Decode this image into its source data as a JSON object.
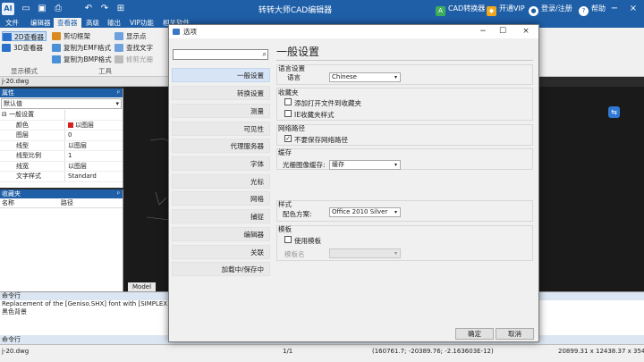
{
  "titlebar": {
    "logo": "AI",
    "title": "转转大师CAD编辑器",
    "converter": "CAD转换器",
    "vip": "开通VIP",
    "login": "登录/注册",
    "help": "帮助"
  },
  "menu": {
    "tabs": [
      "文件",
      "编辑器",
      "查看器",
      "高级",
      "输出",
      "VIP功能",
      "相关软件"
    ]
  },
  "ribbon": {
    "btn_2d": "2D查看器",
    "btn_3d": "3D查看器",
    "btn_clip": "剪切框架",
    "btn_emf": "复制为EMF格式",
    "btn_bmp": "复制为BMP格式",
    "btn_points": "显示点",
    "btn_find": "查找文字",
    "btn_trim": "修剪光栅",
    "group_display": "显示模式",
    "group_tools": "工具"
  },
  "file_tab": "j-20.dwg",
  "properties": {
    "header": "属性",
    "combo_value": "默认值",
    "group": "一般设置",
    "rows": [
      {
        "k": "颜色",
        "v": "以图层"
      },
      {
        "k": "图层",
        "v": "0"
      },
      {
        "k": "线型",
        "v": "以图层"
      },
      {
        "k": "线型比例",
        "v": "1"
      },
      {
        "k": "线宽",
        "v": "以图层"
      },
      {
        "k": "文字样式",
        "v": "Standard"
      }
    ]
  },
  "favorites": {
    "header": "收藏夹",
    "col_name": "名称",
    "col_path": "路径"
  },
  "canvas": {
    "model_tab": "Model"
  },
  "command": {
    "header": "命令行",
    "lines": [
      "Replacement of the [Geniso.SHX] font with [SIMPLEX.SHX]",
      "黑色背景"
    ],
    "prompt_label": "命令行"
  },
  "status": {
    "file": "j-20.dwg",
    "page": "1/1",
    "coords": "(160761.7; -20389.76; -2.163603E-12)",
    "size": "20899.31 x 12438.37 x 3545.365"
  },
  "dialog": {
    "title": "选项",
    "search_placeholder": "",
    "nav": [
      "一般设置",
      "转换设置",
      "测量",
      "可见性",
      "代理服务器",
      "字体",
      "光标",
      "网格",
      "捕捉",
      "编辑器",
      "关联",
      "加载中/保存中"
    ],
    "heading": "一般设置",
    "language_section": "语言设置",
    "language_label": "语言",
    "language_value": "Chinese",
    "favorites_section": "收藏夹",
    "fav_opt1": "添加打开文件到收藏夹",
    "fav_opt2": "IE收藏夹样式",
    "network_section": "网络路径",
    "net_opt": "不要保存网络路径",
    "cache_section": "缓存",
    "cache_label": "光栅图像缓存:",
    "cache_value": "缓存",
    "style_section": "样式",
    "style_label": "配色方案:",
    "style_value": "Office 2010 Silver",
    "template_section": "模板",
    "template_opt": "使用模板",
    "template_label": "模板名",
    "ok": "确定",
    "cancel": "取消"
  },
  "colors": {
    "accent": "#1f5fa8",
    "nav_active": "#d6e4f5"
  }
}
